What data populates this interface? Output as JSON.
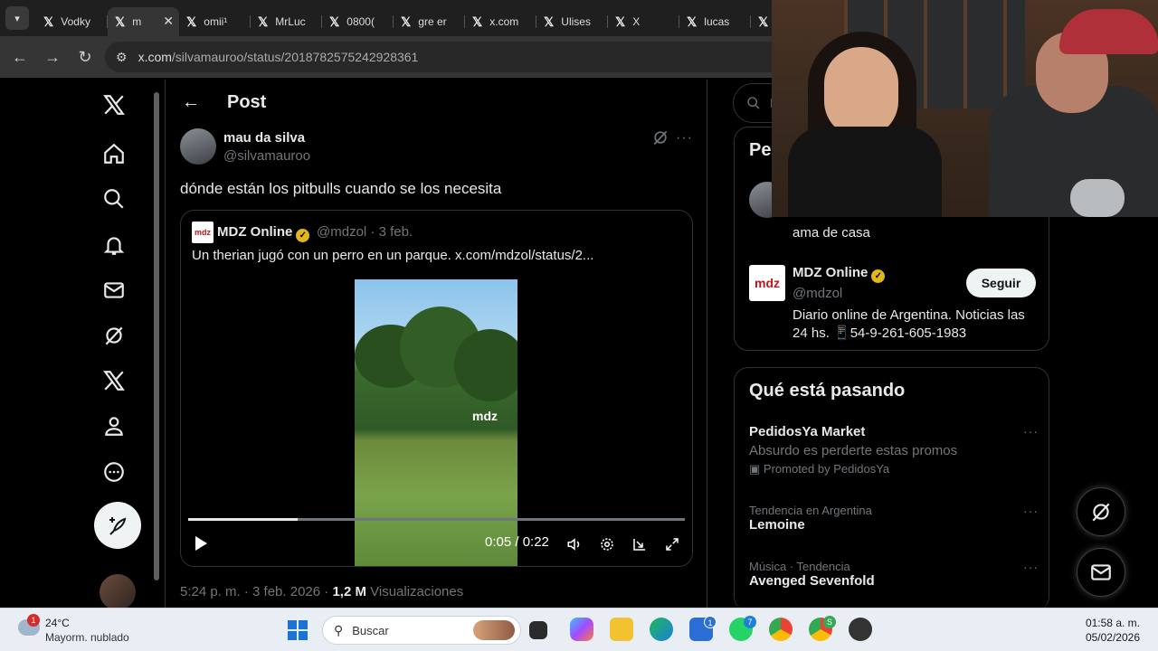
{
  "browser": {
    "tabs": [
      {
        "label": "Vodky"
      },
      {
        "label": "m",
        "active": true
      },
      {
        "label": "omii¹"
      },
      {
        "label": "MrLuc"
      },
      {
        "label": "0800("
      },
      {
        "label": "gre er"
      },
      {
        "label": "x.com"
      },
      {
        "label": "Ulises"
      },
      {
        "label": "X"
      },
      {
        "label": "lucas"
      },
      {
        "label": ""
      }
    ],
    "url_host": "x.com",
    "url_path": "/silvamauroo/status/2018782575242928361"
  },
  "x": {
    "header_title": "Post",
    "tweet": {
      "author_name": "mau da silva",
      "author_handle": "@silvamauroo",
      "text": "dónde están los pitbulls cuando se los necesita",
      "timestamp": "5:24 p. m. · 3 feb. 2026 ·",
      "views_count": "1,2 M",
      "views_label": "Visualizaciones"
    },
    "quote": {
      "logo_text": "mdz",
      "name": "MDZ Online",
      "handle_date": "@mdzol · 3 feb.",
      "text": "Un therian jugó con un perro en un parque.  x.com/mdzol/status/2...",
      "video_watermark": "mdz",
      "video_time": "0:05 / 0:22",
      "video_progress": 0.22
    },
    "sidebar_right": {
      "search_placeholder": "B",
      "people_title": "Pe",
      "first_bio": "ama de casa",
      "account": {
        "logo_text": "mdz",
        "name": "MDZ Online",
        "handle": "@mdzol",
        "follow_label": "Seguir",
        "bio": "Diario online de Argentina. Noticias las 24 hs. 📱54-9-261-605-1983"
      },
      "trends_title": "Qué está pasando",
      "trends": [
        {
          "title": "PedidosYa Market",
          "desc": "Absurdo es perderte estas promos",
          "promo": "Promoted by PedidosYa"
        },
        {
          "sub": "Tendencia en Argentina",
          "title": "Lemoine"
        },
        {
          "sub": "Música · Tendencia",
          "title": "Avenged Sevenfold"
        }
      ]
    }
  },
  "taskbar": {
    "weather_temp": "24°C",
    "weather_desc": "Mayorm. nublado",
    "weather_badge": "1",
    "search_placeholder": "Buscar",
    "store_badge": "1",
    "whatsapp_badge": "7",
    "chrome2_badge": "S",
    "time": "01:58 a. m.",
    "date": "05/02/2026"
  },
  "colors": {
    "background": "#000000",
    "text": "#e7e9ea",
    "muted": "#71767b",
    "border": "#2f3336",
    "verified": "#e2b719",
    "mdz_red": "#c0141b"
  }
}
